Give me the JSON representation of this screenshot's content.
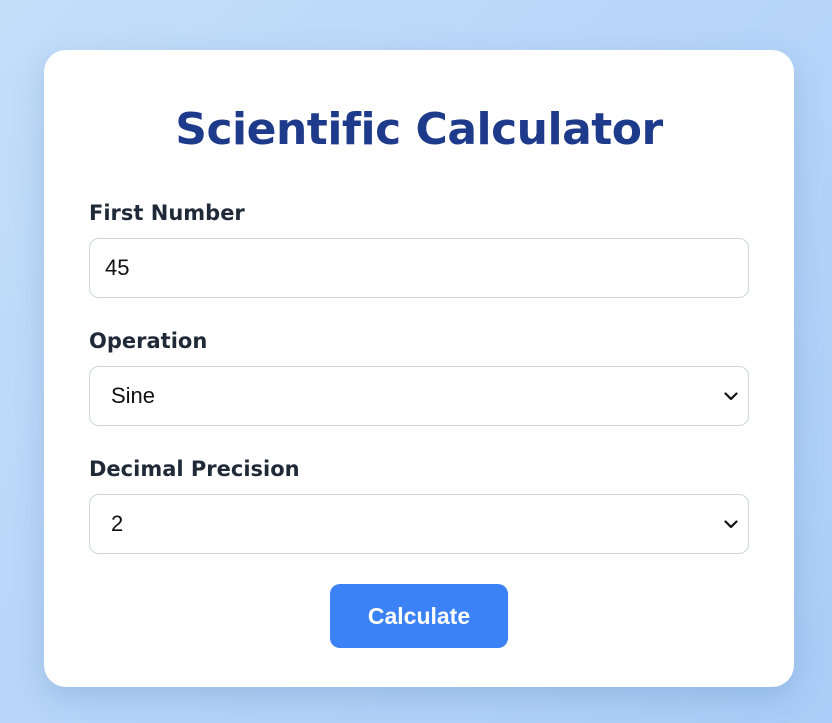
{
  "title": "Scientific Calculator",
  "first_number": {
    "label": "First Number",
    "value": "45"
  },
  "operation": {
    "label": "Operation",
    "selected": "Sine",
    "icon": "chevron-down-icon"
  },
  "precision": {
    "label": "Decimal Precision",
    "selected": "2",
    "icon": "chevron-down-icon"
  },
  "calculate_button": {
    "label": "Calculate"
  },
  "colors": {
    "background": "#b9d7f9",
    "title": "#1e3a8a",
    "button": "#3b82f6",
    "label": "#1f2937"
  }
}
